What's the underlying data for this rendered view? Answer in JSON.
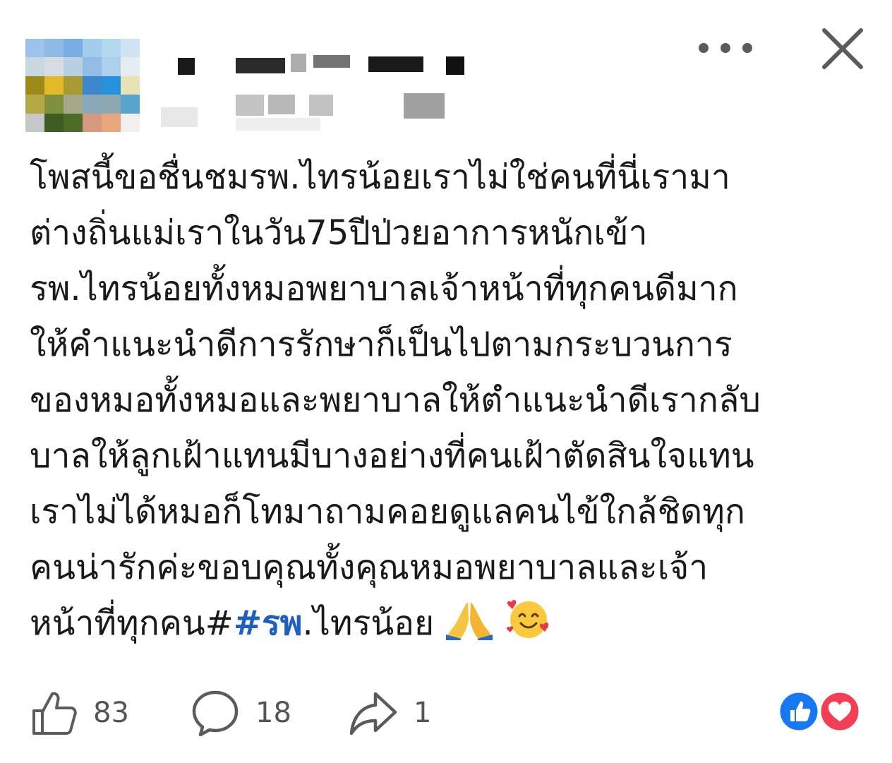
{
  "header": {
    "avatar_colors": [
      "#9fc3e8",
      "#8eb9e3",
      "#7aaee0",
      "#a5cbe9",
      "#b7d7ef",
      "#cfe3f3",
      "#c9d7e0",
      "#d5dde3",
      "#b9d0e0",
      "#94bde4",
      "#aed0ea",
      "#e5edf2",
      "#9c8a20",
      "#e0b930",
      "#a89a3a",
      "#3f86c9",
      "#2a90d8",
      "#e9e2b8",
      "#b3a94a",
      "#7e9040",
      "#a7a88a",
      "#8aa8b7",
      "#8fa8b0",
      "#5aa3c9",
      "#c6c7c9",
      "#3e5c24",
      "#4d6a2a",
      "#d49a80",
      "#e5a880",
      "#f2f0ef"
    ],
    "more_icon": "more-horizontal-icon",
    "close_icon": "close-icon"
  },
  "post": {
    "lines": [
      "โพสนี้ขอชื่นชมรพ.ไทรน้อยเราไม่ใช่คนที่นี่เรามา",
      "ต่างถิ่นแม่เราในวัน75ปีป่วยอาการหนักเข้า",
      "รพ.ไทรน้อยทั้งหมอพยาบาลเจ้าหน้าที่ทุกคนดีมาก",
      "ให้คำแนะนำดีการรักษาก็เป็นไปตามกระบวนการ",
      "ของหมอทั้งหมอและพยาบาลให้ตำแนะนำดีเรากลับ",
      "บาลให้ลูกเฝ้าแทนมีบางอย่างที่คนเฝ้าตัดสินใจแทน",
      "เราไม่ได้หมอก็โทมาถามคอยดูแลคนไข้ใกล้ชิดทุก",
      "คนน่ารักค่ะขอบคุณทั้งคุณหมอพยาบาลและเจ้า"
    ],
    "last_line_prefix": "หน้าที่ทุกคน#",
    "hashtag": "#รพ",
    "last_line_suffix": ".ไทรน้อย",
    "emojis": [
      "folded-hands-emoji",
      "smiling-face-with-hearts-emoji"
    ]
  },
  "actions": {
    "like_count": "83",
    "comment_count": "18",
    "share_count": "1"
  },
  "colors": {
    "hashtag": "#1f5fbf",
    "like_badge": "#1877f2",
    "love_badge": "#f33e58",
    "icon_gray": "#5b5b5b"
  }
}
